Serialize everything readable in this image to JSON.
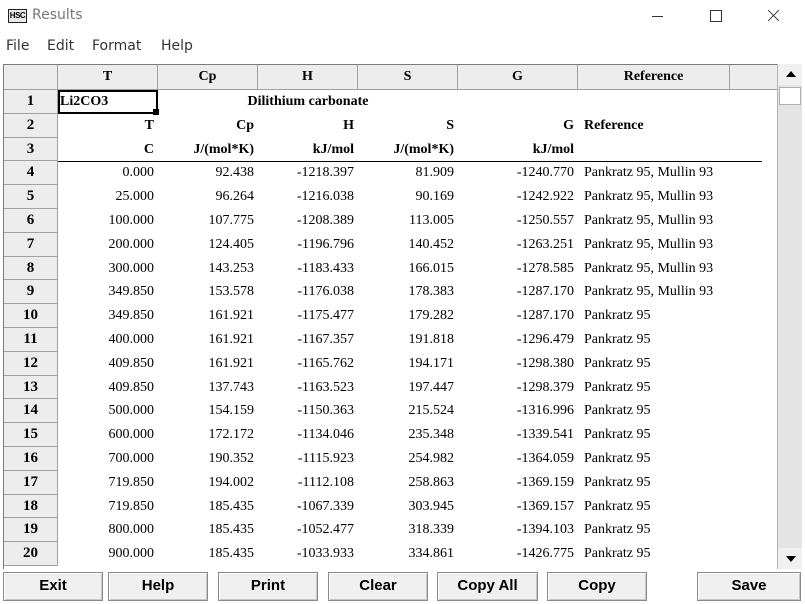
{
  "window": {
    "icon_text": "HSC",
    "title": "Results"
  },
  "menu": [
    "File",
    "Edit",
    "Format",
    "Help"
  ],
  "grid": {
    "columns": [
      "T",
      "Cp",
      "H",
      "S",
      "G",
      "Reference"
    ],
    "rows": [
      {
        "num": "1",
        "cells": [
          "Li2CO3",
          "Dilithium carbonate",
          "",
          "",
          "",
          ""
        ]
      },
      {
        "num": "2",
        "cells": [
          "T",
          "Cp",
          "H",
          "S",
          "G",
          "Reference"
        ]
      },
      {
        "num": "3",
        "cells": [
          "C",
          "J/(mol*K)",
          "kJ/mol",
          "J/(mol*K)",
          "kJ/mol",
          ""
        ]
      },
      {
        "num": "4",
        "cells": [
          "0.000",
          "92.438",
          "-1218.397",
          "81.909",
          "-1240.770",
          "Pankratz 95, Mullin 93"
        ]
      },
      {
        "num": "5",
        "cells": [
          "25.000",
          "96.264",
          "-1216.038",
          "90.169",
          "-1242.922",
          "Pankratz 95, Mullin 93"
        ]
      },
      {
        "num": "6",
        "cells": [
          "100.000",
          "107.775",
          "-1208.389",
          "113.005",
          "-1250.557",
          "Pankratz 95, Mullin 93"
        ]
      },
      {
        "num": "7",
        "cells": [
          "200.000",
          "124.405",
          "-1196.796",
          "140.452",
          "-1263.251",
          "Pankratz 95, Mullin 93"
        ]
      },
      {
        "num": "8",
        "cells": [
          "300.000",
          "143.253",
          "-1183.433",
          "166.015",
          "-1278.585",
          "Pankratz 95, Mullin 93"
        ]
      },
      {
        "num": "9",
        "cells": [
          "349.850",
          "153.578",
          "-1176.038",
          "178.383",
          "-1287.170",
          "Pankratz 95, Mullin 93"
        ]
      },
      {
        "num": "10",
        "cells": [
          "349.850",
          "161.921",
          "-1175.477",
          "179.282",
          "-1287.170",
          "Pankratz 95"
        ]
      },
      {
        "num": "11",
        "cells": [
          "400.000",
          "161.921",
          "-1167.357",
          "191.818",
          "-1296.479",
          "Pankratz 95"
        ]
      },
      {
        "num": "12",
        "cells": [
          "409.850",
          "161.921",
          "-1165.762",
          "194.171",
          "-1298.380",
          "Pankratz 95"
        ]
      },
      {
        "num": "13",
        "cells": [
          "409.850",
          "137.743",
          "-1163.523",
          "197.447",
          "-1298.379",
          "Pankratz 95"
        ]
      },
      {
        "num": "14",
        "cells": [
          "500.000",
          "154.159",
          "-1150.363",
          "215.524",
          "-1316.996",
          "Pankratz 95"
        ]
      },
      {
        "num": "15",
        "cells": [
          "600.000",
          "172.172",
          "-1134.046",
          "235.348",
          "-1339.541",
          "Pankratz 95"
        ]
      },
      {
        "num": "16",
        "cells": [
          "700.000",
          "190.352",
          "-1115.923",
          "254.982",
          "-1364.059",
          "Pankratz 95"
        ]
      },
      {
        "num": "17",
        "cells": [
          "719.850",
          "194.002",
          "-1112.108",
          "258.863",
          "-1369.159",
          "Pankratz 95"
        ]
      },
      {
        "num": "18",
        "cells": [
          "719.850",
          "185.435",
          "-1067.339",
          "303.945",
          "-1369.157",
          "Pankratz 95"
        ]
      },
      {
        "num": "19",
        "cells": [
          "800.000",
          "185.435",
          "-1052.477",
          "318.339",
          "-1394.103",
          "Pankratz 95"
        ]
      },
      {
        "num": "20",
        "cells": [
          "900.000",
          "185.435",
          "-1033.933",
          "334.861",
          "-1426.775",
          "Pankratz 95"
        ]
      }
    ]
  },
  "buttons": [
    "Exit",
    "Help",
    "Print",
    "Clear",
    "Copy All",
    "Copy",
    "Save"
  ]
}
